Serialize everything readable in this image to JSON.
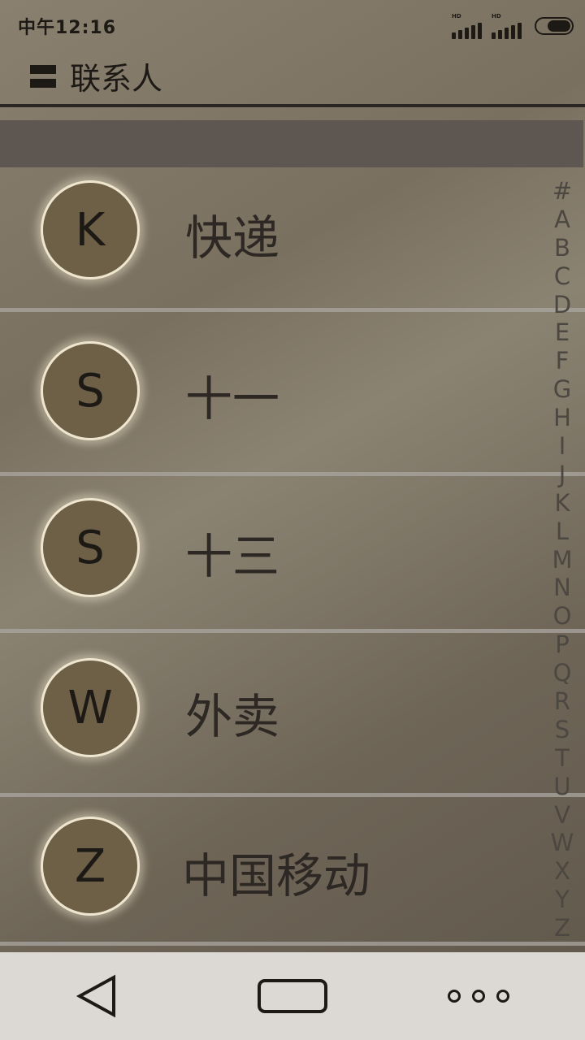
{
  "status_bar": {
    "time": "中午12:16",
    "signal_1_label": "HD",
    "signal_2_label": "HD"
  },
  "header": {
    "title": "联系人"
  },
  "contacts": [
    {
      "initial": "K",
      "name": "快递"
    },
    {
      "initial": "S",
      "name": "十一"
    },
    {
      "initial": "S",
      "name": "十三"
    },
    {
      "initial": "W",
      "name": "外卖"
    },
    {
      "initial": "Z",
      "name": "中国移动"
    }
  ],
  "index_letters": [
    "#",
    "A",
    "B",
    "C",
    "D",
    "E",
    "F",
    "G",
    "H",
    "I",
    "J",
    "K",
    "L",
    "M",
    "N",
    "O",
    "P",
    "Q",
    "R",
    "S",
    "T",
    "U",
    "V",
    "W",
    "X",
    "Y",
    "Z"
  ],
  "nav_bar": {
    "icons": [
      "back-triangle-icon",
      "home-rect-icon",
      "more-dots-icon"
    ]
  },
  "colors": {
    "avatar_fill": "#6e5f47",
    "avatar_ring": "#efe6d0",
    "search_strip": "#5d5651",
    "nav_bar": "#dcd8d4"
  }
}
